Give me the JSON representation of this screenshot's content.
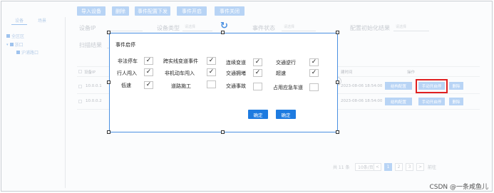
{
  "toolbar": {
    "buttons": [
      "导入设备",
      "删除",
      "事件配置下发",
      "事件开启",
      "事件关闭"
    ]
  },
  "left_panel": {
    "tabs": [
      "设备",
      "场景"
    ],
    "tree": [
      "全区区",
      "浙口",
      "沪浦路口"
    ]
  },
  "filters": {
    "device_ip_label": "设备IP",
    "device_type_label": "设备类型",
    "device_type_placeholder": "请选择",
    "event_status_label": "事件状态",
    "event_status_placeholder": "请选择",
    "init_result_label": "配置初始化结果",
    "init_result_placeholder": "请选择",
    "scan_result_label": "扫描结果"
  },
  "table": {
    "headers": {
      "device_ip": "设备IP",
      "time": "建时间",
      "ops": "操作"
    },
    "rows": [
      {
        "ip": "10.0.0.1",
        "time": "2023-08-06 18:54:00"
      },
      {
        "ip": "10.0.0.2",
        "time": "2023-08-06 18:54:00"
      }
    ],
    "row_actions": {
      "config": "结构配置",
      "manual": "手动开启停",
      "delete": "删除"
    }
  },
  "pagination": {
    "total": "共 11 条",
    "page_size": "10条/页",
    "pages": [
      "1",
      "2",
      "3"
    ],
    "prev": "<",
    "next": ">",
    "goto": "前往"
  },
  "modal": {
    "title": "事件启停",
    "events": [
      {
        "label": "非法停车",
        "checked": true
      },
      {
        "label": "跨实线变道事件",
        "checked": true
      },
      {
        "label": "连续变道",
        "checked": true
      },
      {
        "label": "交通逆行",
        "checked": true
      },
      {
        "label": "行人闯入",
        "checked": true
      },
      {
        "label": "非机动车闯入",
        "checked": true
      },
      {
        "label": "交通拥堵",
        "checked": true
      },
      {
        "label": "超速",
        "checked": true
      },
      {
        "label": "低速",
        "checked": true
      },
      {
        "label": "道路施工",
        "checked": false
      },
      {
        "label": "交通事故",
        "checked": false
      },
      {
        "label": "占用应急车道",
        "checked": false
      }
    ],
    "confirm_labels": [
      "确定",
      "确定"
    ]
  },
  "watermark": "CSDN @一条咸鱼儿",
  "icons": {
    "refresh": "refresh-icon",
    "check": "check-icon"
  },
  "colors": {
    "primary": "#1e7be0",
    "muted_primary": "#b8d4f5",
    "highlight": "#e02020"
  }
}
